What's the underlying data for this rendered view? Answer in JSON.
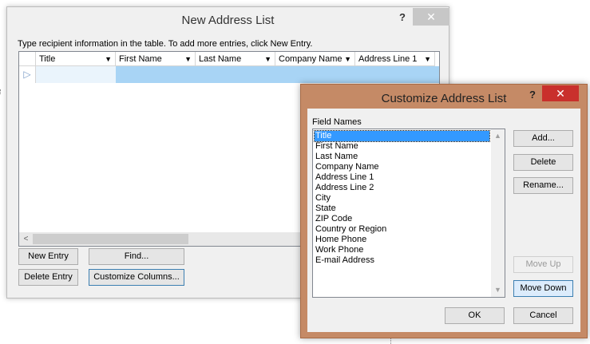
{
  "new_address_list": {
    "title": "New Address List",
    "help": "?",
    "close": "✕",
    "instruction": "Type recipient information in the table.  To add more entries, click New Entry.",
    "columns": [
      "Title",
      "First Name",
      "Last Name",
      "Company Name",
      "Address Line 1"
    ],
    "buttons": {
      "new_entry": "New Entry",
      "find": "Find...",
      "delete_entry": "Delete Entry",
      "customize_columns": "Customize Columns..."
    }
  },
  "customize_dialog": {
    "title": "Customize Address List",
    "help": "?",
    "close": "✕",
    "field_names_label": "Field Names",
    "selected_field": "Title",
    "fields": [
      "Title",
      "First Name",
      "Last Name",
      "Company Name",
      "Address Line 1",
      "Address Line 2",
      "City",
      "State",
      "ZIP Code",
      "Country or Region",
      "Home Phone",
      "Work Phone",
      "E-mail Address"
    ],
    "buttons": {
      "add": "Add...",
      "delete": "Delete",
      "rename": "Rename...",
      "move_up": "Move Up",
      "move_down": "Move Down",
      "ok": "OK",
      "cancel": "Cancel"
    }
  }
}
